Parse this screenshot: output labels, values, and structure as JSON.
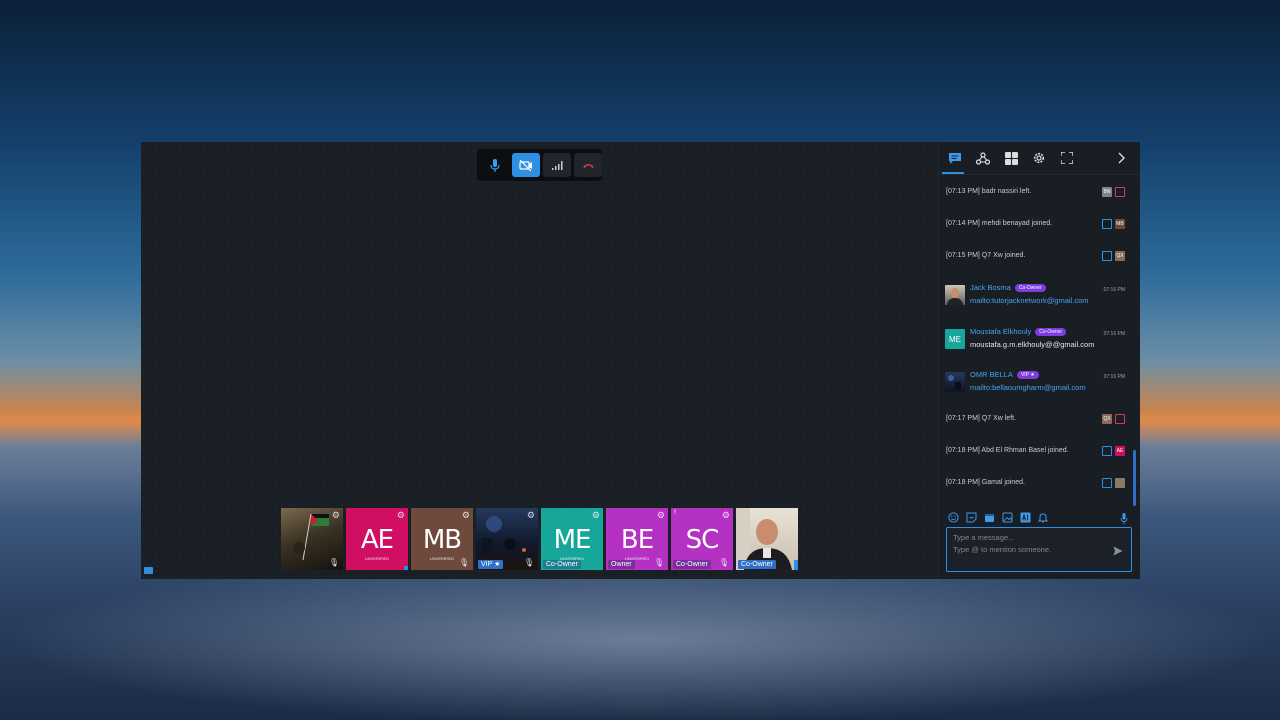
{
  "controls": {
    "mic": "microphone-icon",
    "camera_off": "camera-off-icon",
    "signal": "signal-icon",
    "hangup": "hangup-icon"
  },
  "participants": [
    {
      "initials": "",
      "sub": "",
      "tag": "",
      "color": "#4a4030",
      "photo": "flag-photo"
    },
    {
      "initials": "AE",
      "sub": "UNVERIFIED",
      "tag": "",
      "color": "#d10f62"
    },
    {
      "initials": "MB",
      "sub": "UNVERIFIED",
      "tag": "",
      "color": "#6e4a3c"
    },
    {
      "initials": "",
      "sub": "",
      "tag": "VIP ★",
      "color": "#1c2a44",
      "photo": "night-scene-photo"
    },
    {
      "initials": "ME",
      "sub": "UNVERIFIED",
      "tag": "Co-Owner",
      "color": "#17a79a"
    },
    {
      "initials": "BE",
      "sub": "UNVERIFIED",
      "tag": "Owner",
      "color": "#b431c4"
    },
    {
      "initials": "SC",
      "sub": "",
      "tag": "Co-Owner",
      "color": "#b431c4"
    },
    {
      "initials": "",
      "sub": "",
      "tag": "Co-Owner",
      "color": "#c9c2b6",
      "photo": "webcam-photo"
    }
  ],
  "panel": {
    "tabs": [
      "chat-icon",
      "share-icon",
      "grid-icon",
      "gear-icon",
      "fullscreen-icon"
    ],
    "close": "chevron-right-icon"
  },
  "feed": {
    "sys1": "[07:13 PM] badr nassiri left.",
    "sys2": "[07:14 PM] mehdi benayad joined.",
    "sys3": "[07:15 PM] Q7 Xw joined.",
    "m1": {
      "name": "Jack Bosma",
      "badge": "Co-Owner",
      "time": "07:16 PM",
      "body": "mailto:tutorjacknetwork@gmail.com"
    },
    "m2": {
      "name": "Moustafa Elkhouly",
      "badge": "Co-Owner",
      "time": "07:16 PM",
      "body": "moustafa.g.m.elkhouly@@gmail.com",
      "avatar": "ME"
    },
    "m3": {
      "name": "OMR BELLA",
      "badge": "VIP ★",
      "time": "07:16 PM",
      "body": "mailto:bellaoumgharm@gmail.com"
    },
    "sys4": "[07:17 PM] Q7 Xw left.",
    "sys5": "[07:18 PM] Abd El Rhman Basel joined.",
    "sys6": "[07:18 PM] Gamal joined.",
    "badges": {
      "bn": "BN",
      "mb": "MB",
      "qx": "QX",
      "ae": "AE"
    }
  },
  "composer": {
    "placeholder": "Type a message...\nType @ to mention someone."
  }
}
